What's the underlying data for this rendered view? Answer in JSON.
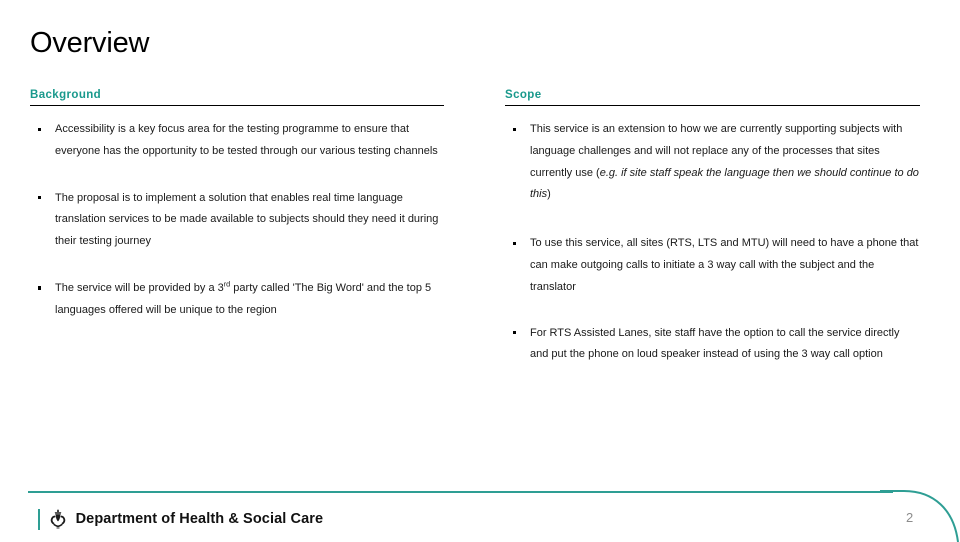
{
  "slide": {
    "title": "Overview",
    "page_number": "2",
    "accent_color": "#19998c",
    "footer_rule_color": "#2e9e94",
    "heading_rule_color": "#000000",
    "title_color": "#000000",
    "page_number_color": "#8c8c8c"
  },
  "columns": {
    "left": {
      "heading": "Background",
      "bullets": [
        "Accessibility is a key focus area for the testing programme to ensure that everyone has the opportunity to be tested through our various testing channels",
        "The proposal is to implement a solution that enables real time language translation services to be made available to subjects should they need it during their testing journey",
        {
          "part1": "The service will be provided by a 3",
          "sup": "rd",
          "part2": " party called 'The Big Word' and the top 5 languages offered will be unique to the region"
        }
      ]
    },
    "right": {
      "heading": "Scope",
      "bullets": [
        {
          "plain": "This service is an extension to how we are currently supporting subjects with language challenges and will not replace any of the processes that sites currently use (",
          "italic": "e.g. if site staff speak the language then we should continue to do this",
          "tail": ")"
        },
        "To use this service, all sites (RTS, LTS and MTU) will need to have a phone that can make outgoing calls to initiate a 3 way call with the subject and the translator",
        "For RTS Assisted Lanes, site staff have the option to call the service directly and put the phone on loud speaker instead of using the 3 way call option"
      ]
    }
  },
  "footer": {
    "logo_text": "Department of Health & Social Care",
    "crest_icon": "royal-crest-icon"
  }
}
